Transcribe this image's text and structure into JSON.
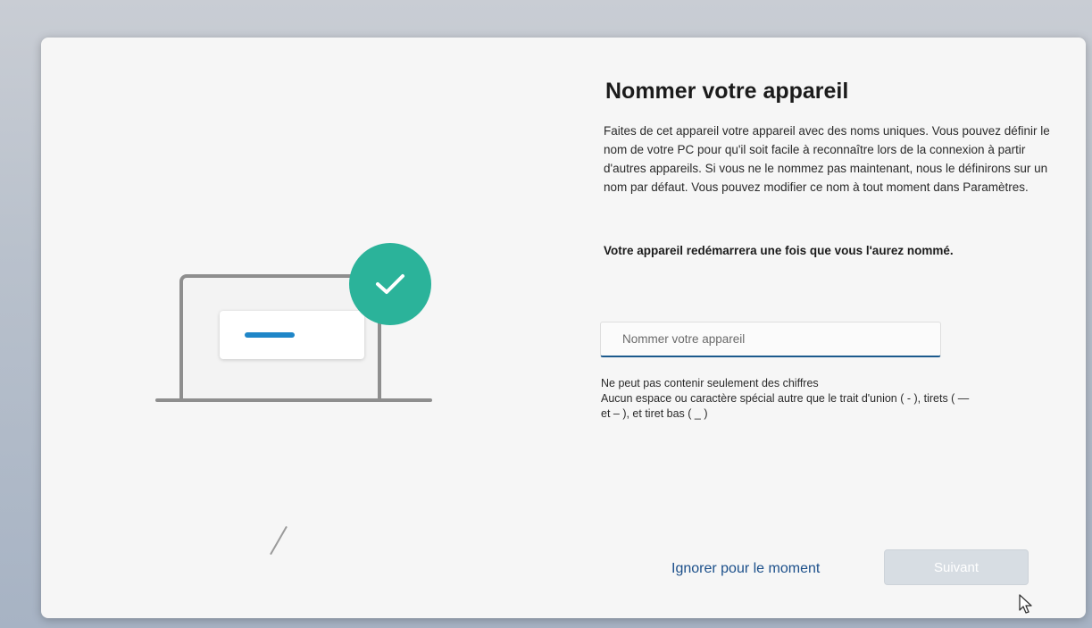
{
  "page": {
    "title": "Nommer votre appareil",
    "description": "Faites de cet appareil votre appareil avec des noms uniques. Vous pouvez définir le nom de votre PC pour qu'il soit facile à reconnaître lors de la connexion à partir d'autres appareils. Si vous ne le nommez pas maintenant, nous le définirons sur un nom par défaut. Vous pouvez modifier ce nom à tout moment dans Paramètres.",
    "restart_note": "Votre appareil redémarrera une fois que vous l'aurez nommé."
  },
  "input": {
    "placeholder": "Nommer votre appareil",
    "value": ""
  },
  "rules": {
    "line1": "Ne peut pas contenir seulement des chiffres",
    "line2": "Aucun espace ou caractère spécial autre que le trait d'union ( - ), tirets ( — et – ), et tiret bas ( _ )"
  },
  "actions": {
    "skip_label": "Ignorer pour le moment",
    "next_label": "Suivant"
  },
  "colors": {
    "accent": "#1c5a8d",
    "check_badge": "#2bb39a",
    "link": "#1b4f8a",
    "next_disabled": "#d7dde3"
  },
  "icons": {
    "check": "check-icon",
    "cursor": "mouse-pointer-icon"
  }
}
